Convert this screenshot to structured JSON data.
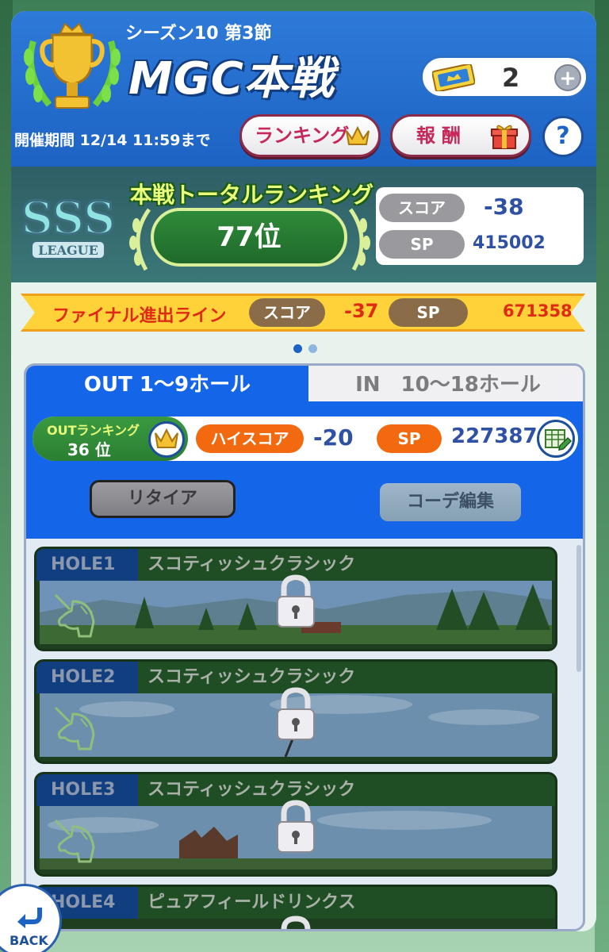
{
  "header": {
    "season": "シーズン10 第3節",
    "title": "MGC本戦",
    "ticket_count": "2",
    "plus": "+",
    "period": "開催期間 12/14 11:59まで",
    "ranking_button": "ランキング",
    "reward_button": "報酬",
    "help_button": "?"
  },
  "league": {
    "badge_text": "SSS",
    "badge_sub": "LEAGUE",
    "total_title": "本戦トータルランキング",
    "total_rank": "77位",
    "score_label": "スコア",
    "score_value": "-38",
    "sp_label": "SP",
    "sp_value": "415002"
  },
  "final_line": {
    "label": "ファイナル進出ライン",
    "score_label": "スコア",
    "score_value": "-37",
    "sp_label": "SP",
    "sp_value": "671358"
  },
  "pager": {
    "active_index": 0,
    "count": 2
  },
  "tabs": {
    "out_label": "OUT 1〜9ホール",
    "in_label": "IN　10〜18ホール"
  },
  "out_panel": {
    "ranking_label": "OUTランキング",
    "ranking_value": "36 位",
    "high_score_label": "ハイスコア",
    "high_score_value": "-20",
    "sp_label": "SP",
    "sp_value": "227387",
    "retire_button": "リタイア",
    "coordinate_button": "コーデ編集"
  },
  "holes": [
    {
      "tag": "HOLE1",
      "name": "スコティッシュクラシック",
      "locked": true
    },
    {
      "tag": "HOLE2",
      "name": "スコティッシュクラシック",
      "locked": true
    },
    {
      "tag": "HOLE3",
      "name": "スコティッシュクラシック",
      "locked": true
    },
    {
      "tag": "HOLE4",
      "name": "ピュアフィールドリンクス",
      "locked": true
    }
  ],
  "back_button": "BACK",
  "colors": {
    "header_blue": "#1d63c4",
    "tab_blue": "#1565e8",
    "ranking_pink": "#c6285a",
    "final_yellow": "#ffd23a",
    "final_red": "#e02a14",
    "score_blue": "#2f51a5",
    "orange": "#f2690f",
    "green": "#2b7f32"
  },
  "icons": [
    "trophy-icon",
    "ticket-icon",
    "plus-icon",
    "crown-icon",
    "gift-icon",
    "help-icon",
    "sss-league-badge",
    "laurel-icon",
    "edit-icon",
    "unicorn-icon",
    "lock-icon",
    "back-arrow-icon"
  ]
}
